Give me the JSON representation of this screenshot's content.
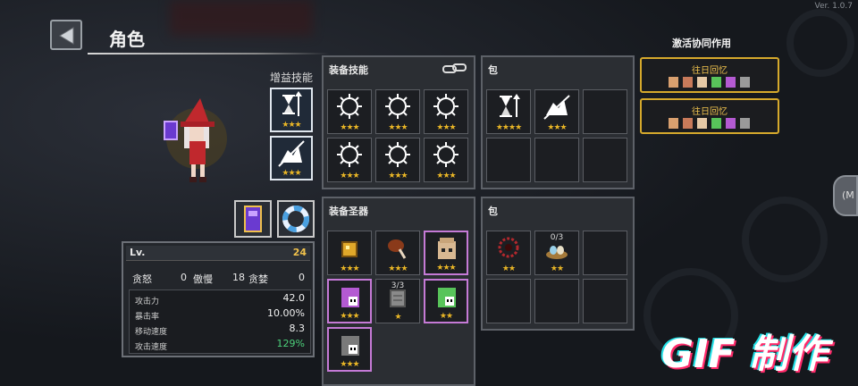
{
  "version": "Ver. 1.0.7",
  "header": {
    "title": "角色"
  },
  "left": {
    "bonus_skills_label": "增益技能",
    "bonus_skills": [
      {
        "icon": "hourglass-arrow-icon",
        "stars": "★★★"
      },
      {
        "icon": "boot-slash-icon",
        "stars": "★★★"
      }
    ],
    "item_buttons": [
      {
        "icon": "spellbook-icon"
      },
      {
        "icon": "lifebuoy-icon"
      }
    ]
  },
  "stats": {
    "lv_label": "Lv.",
    "lv_value": "24",
    "rage_label": "贪怒",
    "rage_value": "0",
    "arrogance_label": "傲慢",
    "greed_value": "18",
    "greed_label": "贪婪",
    "last_value": "0",
    "rows": [
      {
        "label": "攻击力",
        "value": "42.0"
      },
      {
        "label": "暴击率",
        "value": "10.00%"
      },
      {
        "label": "移动速度",
        "value": "8.3"
      },
      {
        "label": "攻击速度",
        "value": "129%"
      }
    ],
    "accent_green": "#4cd07a"
  },
  "equip_skills": {
    "title": "装备技能",
    "link_icon": "chain-link-icon",
    "slots": [
      {
        "icon": "spiked-orb-icon",
        "stars": "★★★"
      },
      {
        "icon": "spiked-orb-icon",
        "stars": "★★★"
      },
      {
        "icon": "spiked-orb-icon",
        "stars": "★★★"
      },
      {
        "icon": "spiked-orb-icon",
        "stars": "★★★"
      },
      {
        "icon": "spiked-orb-icon",
        "stars": "★★★"
      },
      {
        "icon": "spiked-orb-icon",
        "stars": "★★★"
      }
    ]
  },
  "skill_bag": {
    "title": "包",
    "slots": [
      {
        "icon": "hourglass-arrow-icon",
        "stars": "★★★★"
      },
      {
        "icon": "boot-slash-icon",
        "stars": "★★★"
      },
      {},
      {},
      {},
      {}
    ]
  },
  "equip_relics": {
    "title": "装备圣器",
    "slots": [
      {
        "icon": "gold-cube-icon",
        "stars": "★★★",
        "pink": false,
        "count": ""
      },
      {
        "icon": "meat-club-icon",
        "stars": "★★★",
        "pink": false,
        "count": ""
      },
      {
        "icon": "sack-face-icon",
        "stars": "★★★",
        "pink": true,
        "count": ""
      },
      {
        "icon": "purple-ghost-icon",
        "stars": "★★★",
        "pink": true,
        "count": ""
      },
      {
        "icon": "stone-tablet-icon",
        "stars": "★",
        "pink": false,
        "count": "3/3"
      },
      {
        "icon": "green-ghost-icon",
        "stars": "★★",
        "pink": true,
        "count": ""
      },
      {
        "icon": "grey-ghost-icon",
        "stars": "★★★",
        "pink": true,
        "count": ""
      }
    ]
  },
  "relic_bag": {
    "title": "包",
    "slots": [
      {
        "icon": "red-wreath-icon",
        "stars": "★★",
        "count": ""
      },
      {
        "icon": "egg-nest-icon",
        "stars": "★★",
        "count": "0/3"
      },
      {},
      {},
      {},
      {}
    ]
  },
  "sync": {
    "title": "激活协同作用",
    "cards": [
      {
        "name": "往日回忆",
        "colors": [
          "#d9a06f",
          "#c87a5a",
          "#e6c9a6",
          "#58c45a",
          "#b45ad2",
          "#9a9a9a"
        ]
      },
      {
        "name": "往日回忆",
        "colors": [
          "#d9a06f",
          "#c87a5a",
          "#e6c9a6",
          "#58c45a",
          "#b45ad2",
          "#9a9a9a"
        ]
      }
    ]
  },
  "side_knob_label": "(M",
  "watermark": "GIF 制作"
}
